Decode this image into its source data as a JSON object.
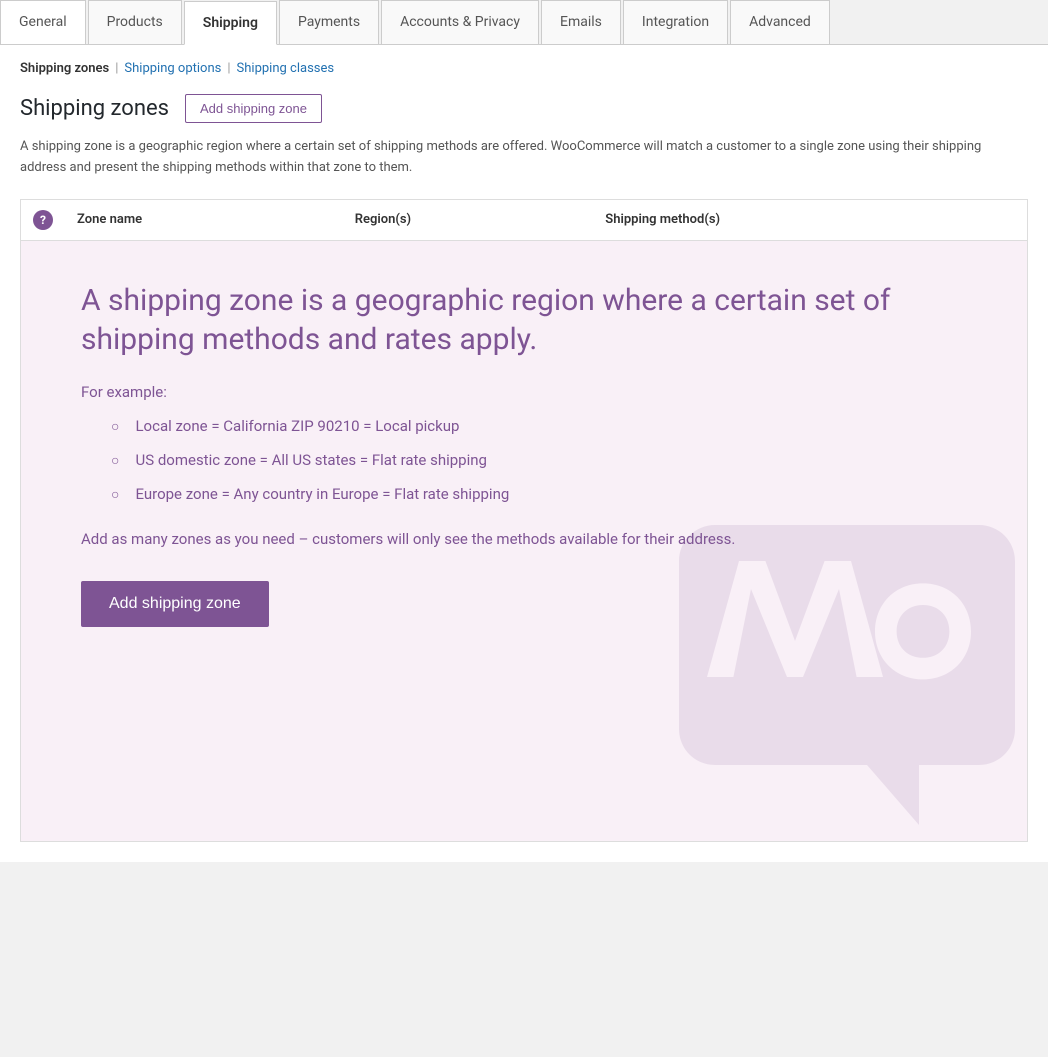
{
  "tabs": [
    {
      "id": "general",
      "label": "General",
      "active": false
    },
    {
      "id": "products",
      "label": "Products",
      "active": false
    },
    {
      "id": "shipping",
      "label": "Shipping",
      "active": true
    },
    {
      "id": "payments",
      "label": "Payments",
      "active": false
    },
    {
      "id": "accounts-privacy",
      "label": "Accounts & Privacy",
      "active": false
    },
    {
      "id": "emails",
      "label": "Emails",
      "active": false
    },
    {
      "id": "integration",
      "label": "Integration",
      "active": false
    },
    {
      "id": "advanced",
      "label": "Advanced",
      "active": false
    }
  ],
  "subnav": [
    {
      "id": "shipping-zones",
      "label": "Shipping zones",
      "active": true
    },
    {
      "id": "shipping-options",
      "label": "Shipping options",
      "active": false
    },
    {
      "id": "shipping-classes",
      "label": "Shipping classes",
      "active": false
    }
  ],
  "section": {
    "title": "Shipping zones",
    "add_btn_label": "Add shipping zone",
    "description": "A shipping zone is a geographic region where a certain set of shipping methods are offered. WooCommerce will match a customer to a single zone using their shipping address and present the shipping methods within that zone to them."
  },
  "table": {
    "col_icon": "",
    "col_zone": "Zone name",
    "col_region": "Region(s)",
    "col_method": "Shipping method(s)"
  },
  "empty_state": {
    "heading": "A shipping zone is a geographic region where a certain set of shipping methods and rates apply.",
    "for_example": "For example:",
    "examples": [
      "Local zone = California ZIP 90210 = Local pickup",
      "US domestic zone = All US states = Flat rate shipping",
      "Europe zone = Any country in Europe = Flat rate shipping"
    ],
    "add_many_text": "Add as many zones as you need – customers will only see the methods available for their address.",
    "add_btn_label": "Add shipping zone"
  },
  "colors": {
    "accent": "#7e5494",
    "accent_light_bg": "#f9f0f7"
  }
}
